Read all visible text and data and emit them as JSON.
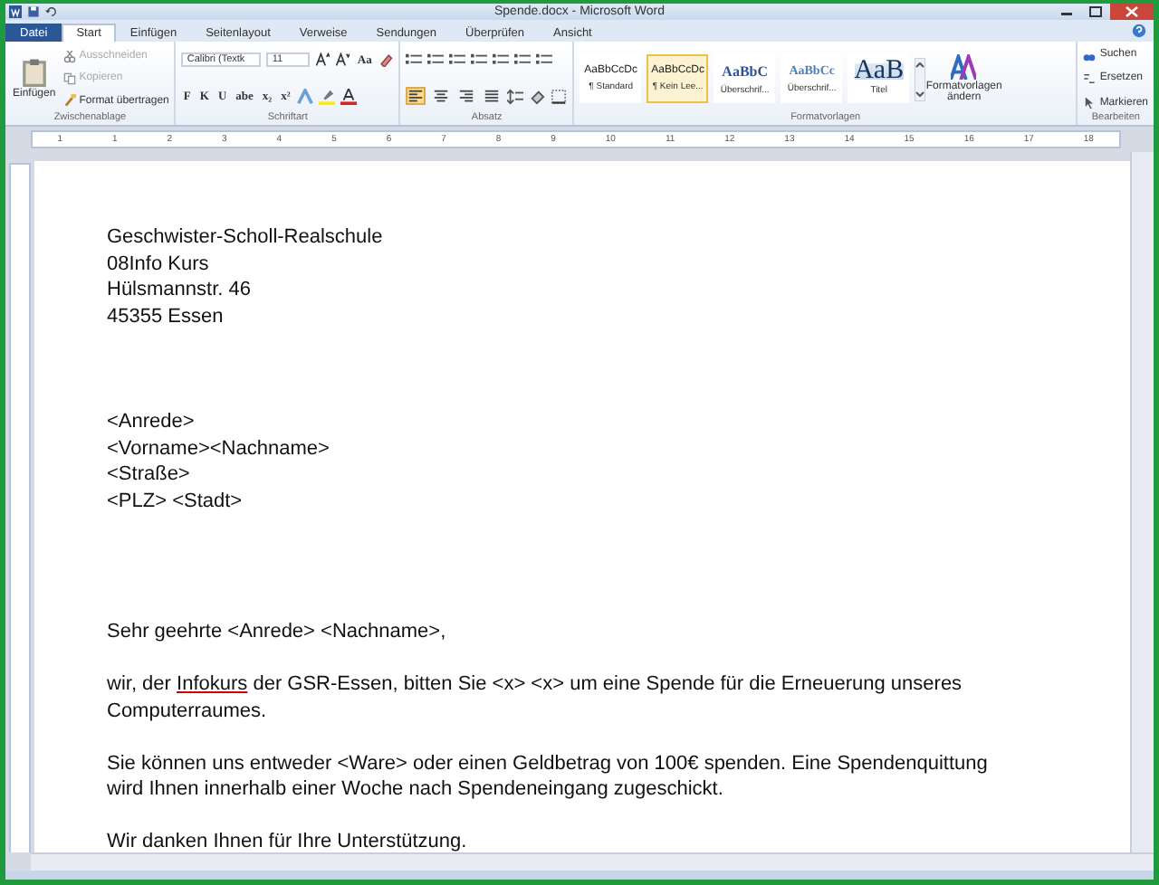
{
  "window": {
    "title": "Spende.docx - Microsoft Word"
  },
  "tabs": [
    {
      "label": "Datei",
      "kind": "file",
      "selected": false
    },
    {
      "label": "Start",
      "kind": "tab",
      "selected": true
    },
    {
      "label": "Einfügen",
      "kind": "tab",
      "selected": false
    },
    {
      "label": "Seitenlayout",
      "kind": "tab",
      "selected": false
    },
    {
      "label": "Verweise",
      "kind": "tab",
      "selected": false
    },
    {
      "label": "Sendungen",
      "kind": "tab",
      "selected": false
    },
    {
      "label": "Überprüfen",
      "kind": "tab",
      "selected": false
    },
    {
      "label": "Ansicht",
      "kind": "tab",
      "selected": false
    }
  ],
  "clipboard": {
    "label": "Zwischenablage",
    "paste": "Einfügen",
    "actions": [
      {
        "label": "Ausschneiden",
        "disabled": true
      },
      {
        "label": "Kopieren",
        "disabled": true
      },
      {
        "label": "Format übertragen",
        "disabled": false
      }
    ]
  },
  "font": {
    "label": "Schriftart",
    "family": "Calibri (Textk",
    "size": "11",
    "case_button": "Aa",
    "format_buttons": [
      "F",
      "K",
      "U",
      "abe",
      "x₂",
      "x²"
    ]
  },
  "paragraph": {
    "label": "Absatz",
    "alignments": [
      {
        "selected": true
      },
      {
        "selected": false
      },
      {
        "selected": false
      },
      {
        "selected": false
      }
    ]
  },
  "styles": {
    "label": "Formatvorlagen",
    "items": [
      {
        "sample": "AaBbCcDc",
        "name": "¶ Standard",
        "kind": "normal",
        "selected": false
      },
      {
        "sample": "AaBbCcDc",
        "name": "¶ Kein Lee...",
        "kind": "normal",
        "selected": true
      },
      {
        "sample": "AaBbC",
        "name": "Überschrif...",
        "kind": "heading1",
        "selected": false
      },
      {
        "sample": "AaBbCc",
        "name": "Überschrif...",
        "kind": "heading2",
        "selected": false
      },
      {
        "sample": "AaB",
        "name": "Titel",
        "kind": "title",
        "selected": false
      }
    ],
    "change_button": "Formatvorlagen ändern"
  },
  "editing": {
    "label": "Bearbeiten",
    "actions": [
      "Suchen",
      "Ersetzen",
      "Markieren"
    ]
  },
  "ruler": {
    "marks": [
      "1",
      "1",
      "2",
      "3",
      "4",
      "5",
      "6",
      "7",
      "8",
      "9",
      "10",
      "11",
      "12",
      "13",
      "14",
      "15",
      "16",
      "17",
      "18"
    ]
  },
  "document": {
    "blocks": [
      {
        "kind": "sender",
        "lines": [
          [
            {
              "text": "Geschwister-Scholl-Realschule"
            }
          ],
          [
            {
              "text": "08Info Kurs"
            }
          ],
          [
            {
              "text": "Hülsmannstr. 46"
            }
          ],
          [
            {
              "text": "45355 Essen"
            }
          ]
        ]
      },
      {
        "kind": "recipient",
        "lines": [
          [
            {
              "text": "<Anrede>"
            }
          ],
          [
            {
              "text": "<Vorname><Nachname>"
            }
          ],
          [
            {
              "text": "<Straße>"
            }
          ],
          [
            {
              "text": "<PLZ> <Stadt>"
            }
          ]
        ]
      },
      {
        "kind": "salutation",
        "lines": [
          [
            {
              "text": "Sehr geehrte <Anrede> <Nachname>,"
            }
          ]
        ]
      },
      {
        "kind": "body",
        "lines": [
          [
            {
              "text": "wir, der "
            },
            {
              "text": "Infokurs",
              "flagged": true
            },
            {
              "text": " der GSR-Essen, bitten Sie <x> <x> um eine Spende für die Erneuerung unseres"
            }
          ],
          [
            {
              "text": "Computerraumes."
            }
          ]
        ]
      },
      {
        "kind": "body",
        "lines": [
          [
            {
              "text": "Sie können uns entweder <Ware> oder einen Geldbetrag von 100€ spenden. Eine Spendenquittung"
            }
          ],
          [
            {
              "text": "wird Ihnen innerhalb einer Woche nach Spendeneingang zugeschickt."
            }
          ]
        ]
      },
      {
        "kind": "body",
        "lines": [
          [
            {
              "text": "Wir danken Ihnen für Ihre Unterstützung."
            }
          ]
        ]
      }
    ]
  }
}
